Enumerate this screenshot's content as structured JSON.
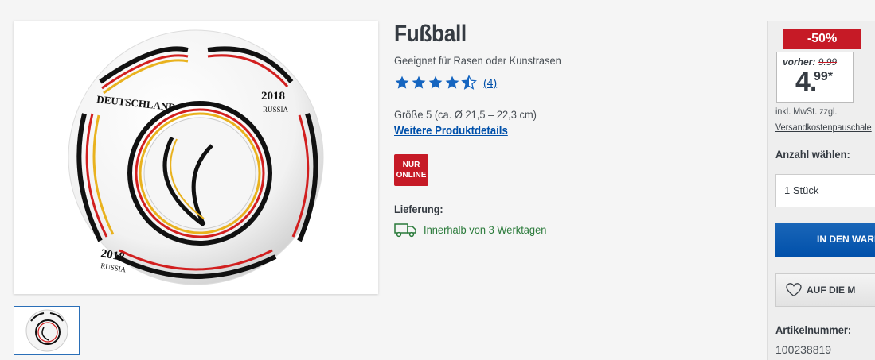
{
  "product": {
    "title": "Fußball",
    "subtitle": "Geeignet für Rasen oder Kunstrasen",
    "rating": {
      "stars": 4.5,
      "max": 5,
      "count_label": "(4)"
    },
    "size": "Größe 5 (ca. Ø 21,5 – 22,3 cm)",
    "details_link": "Weitere Produktdetails",
    "badge": {
      "line1": "NUR",
      "line2": "ONLINE"
    },
    "delivery_label": "Lieferung:",
    "delivery_text": "Innerhalb von 3 Werktagen",
    "image": {
      "print_left": "DEUTSCHLAND",
      "print_year": "2018",
      "print_country": "RUSSIA"
    }
  },
  "buybox": {
    "discount": "-50%",
    "before_label": "vorher:",
    "before_price": "9.99",
    "price_main": "4.",
    "price_cents": "99*",
    "tax_line1": "inkl. MwSt. zzgl.",
    "tax_line2": "Versandkostenpauschale",
    "qty_label": "Anzahl wählen:",
    "qty_value": "1 Stück",
    "cart_button": "IN DEN WARE",
    "wishlist_button": "AUF DIE M",
    "article_label": "Artikelnummer:",
    "article_number": "100238819"
  },
  "colors": {
    "brand_blue": "#0050aa",
    "sale_red": "#c61a26",
    "delivery_green": "#2a7a3a",
    "star_blue": "#1565c0"
  },
  "icons": [
    "star-icon",
    "star-half-icon",
    "truck-icon",
    "heart-icon"
  ]
}
